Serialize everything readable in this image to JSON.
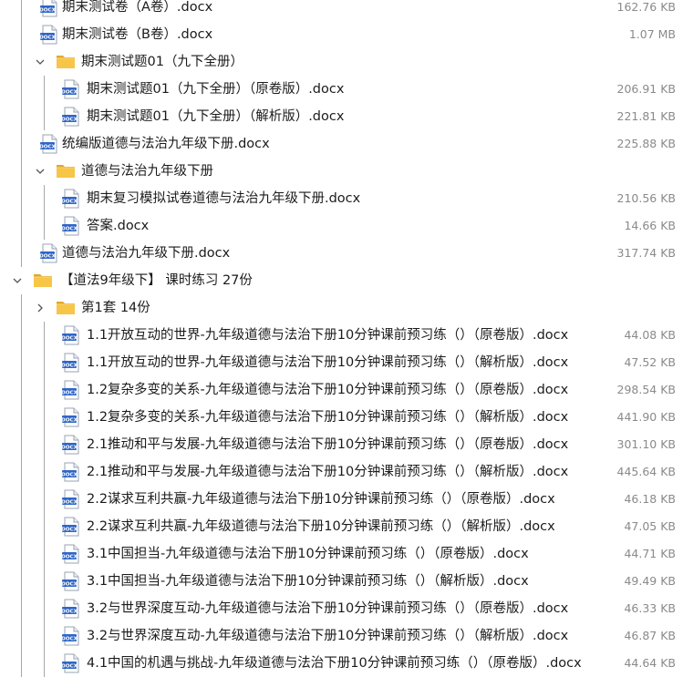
{
  "rows": [
    {
      "type": "file",
      "depth": 1,
      "name": "期末测试卷（A卷）.docx",
      "size": "162.76 KB"
    },
    {
      "type": "file",
      "depth": 1,
      "name": "期末测试卷（B卷）.docx",
      "size": "1.07 MB"
    },
    {
      "type": "folder",
      "depth": 1,
      "expanded": true,
      "name": "期末测试题01（九下全册）"
    },
    {
      "type": "file",
      "depth": 2,
      "name": "期末测试题01（九下全册）（原卷版）.docx",
      "size": "206.91 KB"
    },
    {
      "type": "file",
      "depth": 2,
      "name": "期末测试题01（九下全册）（解析版）.docx",
      "size": "221.81 KB"
    },
    {
      "type": "file",
      "depth": 1,
      "name": "统编版道德与法治九年级下册.docx",
      "size": "225.88 KB"
    },
    {
      "type": "folder",
      "depth": 1,
      "expanded": true,
      "name": "道德与法治九年级下册"
    },
    {
      "type": "file",
      "depth": 2,
      "name": "期末复习模拟试卷道德与法治九年级下册.docx",
      "size": "210.56 KB"
    },
    {
      "type": "file",
      "depth": 2,
      "name": "答案.docx",
      "size": "14.66 KB"
    },
    {
      "type": "file",
      "depth": 1,
      "name": "道德与法治九年级下册.docx",
      "size": "317.74 KB"
    },
    {
      "type": "folder",
      "depth": 0,
      "expanded": true,
      "name": "【道法9年级下】 课时练习 27份"
    },
    {
      "type": "folder",
      "depth": 1,
      "expanded": false,
      "name": "第1套 14份"
    },
    {
      "type": "file",
      "depth": 2,
      "name": "1.1开放互动的世界-九年级道德与法治下册10分钟课前预习练（）（原卷版）.docx",
      "size": "44.08 KB"
    },
    {
      "type": "file",
      "depth": 2,
      "name": "1.1开放互动的世界-九年级道德与法治下册10分钟课前预习练（）（解析版）.docx",
      "size": "47.52 KB"
    },
    {
      "type": "file",
      "depth": 2,
      "name": "1.2复杂多变的关系-九年级道德与法治下册10分钟课前预习练（）（原卷版）.docx",
      "size": "298.54 KB"
    },
    {
      "type": "file",
      "depth": 2,
      "name": "1.2复杂多变的关系-九年级道德与法治下册10分钟课前预习练（）（解析版）.docx",
      "size": "441.90 KB"
    },
    {
      "type": "file",
      "depth": 2,
      "name": "2.1推动和平与发展-九年级道德与法治下册10分钟课前预习练（）（原卷版）.docx",
      "size": "301.10 KB"
    },
    {
      "type": "file",
      "depth": 2,
      "name": "2.1推动和平与发展-九年级道德与法治下册10分钟课前预习练（）（解析版）.docx",
      "size": "445.64 KB"
    },
    {
      "type": "file",
      "depth": 2,
      "name": "2.2谋求互利共赢-九年级道德与法治下册10分钟课前预习练（）（原卷版）.docx",
      "size": "46.18 KB"
    },
    {
      "type": "file",
      "depth": 2,
      "name": "2.2谋求互利共赢-九年级道德与法治下册10分钟课前预习练（）（解析版）.docx",
      "size": "47.05 KB"
    },
    {
      "type": "file",
      "depth": 2,
      "name": "3.1中国担当-九年级道德与法治下册10分钟课前预习练（）（原卷版）.docx",
      "size": "44.71 KB"
    },
    {
      "type": "file",
      "depth": 2,
      "name": "3.1中国担当-九年级道德与法治下册10分钟课前预习练（）（解析版）.docx",
      "size": "49.49 KB"
    },
    {
      "type": "file",
      "depth": 2,
      "name": "3.2与世界深度互动-九年级道德与法治下册10分钟课前预习练（）（原卷版）.docx",
      "size": "46.33 KB"
    },
    {
      "type": "file",
      "depth": 2,
      "name": "3.2与世界深度互动-九年级道德与法治下册10分钟课前预习练（）（解析版）.docx",
      "size": "46.87 KB"
    },
    {
      "type": "file",
      "depth": 2,
      "name": "4.1中国的机遇与挑战-九年级道德与法治下册10分钟课前预习练（）（原卷版）.docx",
      "size": "44.64 KB"
    }
  ],
  "colors": {
    "text": "#1b1b1b",
    "size_text": "#8a8a8a",
    "guide_line": "#a8a8a8",
    "folder_yellow": "#f7c548",
    "folder_dark": "#e2a72d",
    "docx_blue": "#2f66c8"
  },
  "icons": {
    "file": "docx-file-icon",
    "folder": "folder-icon",
    "expanded": "chevron-down-icon",
    "collapsed": "chevron-right-icon"
  }
}
